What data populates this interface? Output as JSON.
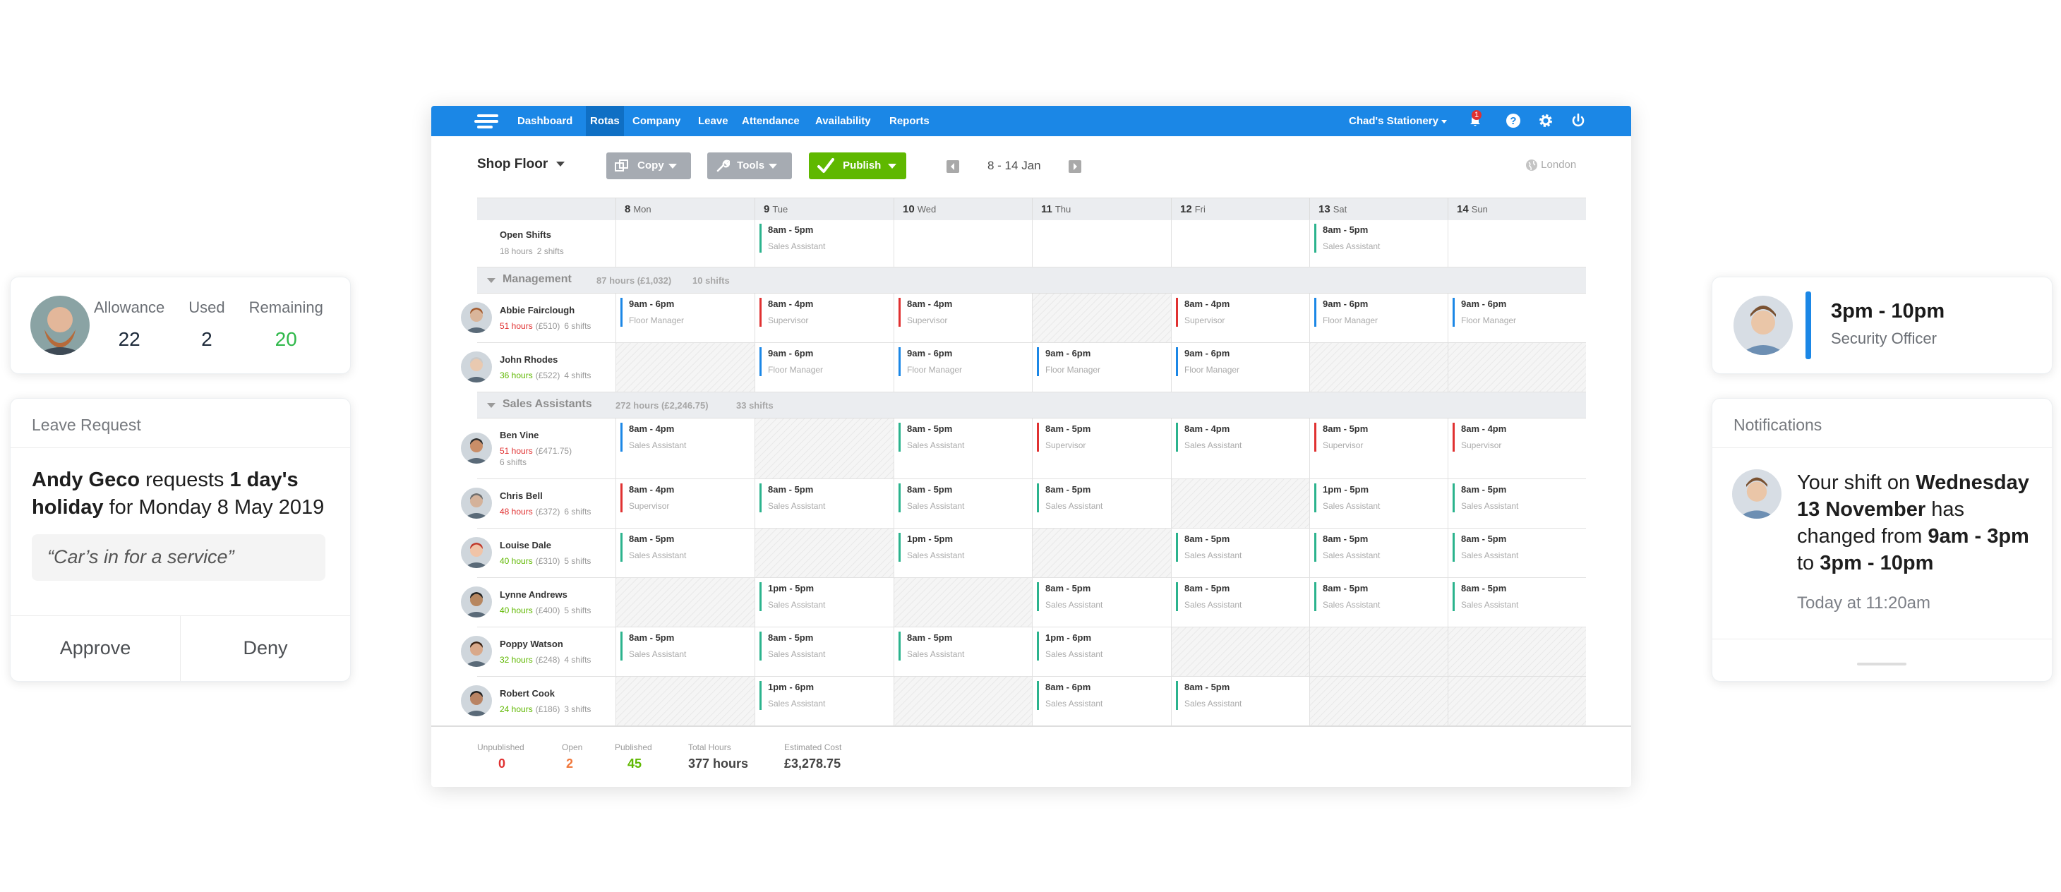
{
  "colors": {
    "brand": "#1b87e6",
    "green": "#5fb800",
    "blue_shift": "#1b87e6",
    "red_shift": "#e03131",
    "teal_shift": "#2bb38d",
    "over_hours": "#e03131",
    "ok_hours": "#5fb800",
    "remaining": "#2fb84a",
    "unpublished": "#e03131",
    "open": "#f0783c",
    "published": "#5fb800"
  },
  "allowance": {
    "allowance_label": "Allowance",
    "allowance_value": "22",
    "used_label": "Used",
    "used_value": "2",
    "remaining_label": "Remaining",
    "remaining_value": "20"
  },
  "leave_request": {
    "title": "Leave Request",
    "name": "Andy Geco",
    "requests": " requests ",
    "duration": "1 day's holiday",
    "for": " for ",
    "date": "Monday 8 May 2019",
    "quote": "“Car’s in for a service”",
    "approve": "Approve",
    "deny": "Deny"
  },
  "shift_card": {
    "time": "3pm - 10pm",
    "role": "Security Officer"
  },
  "notifications": {
    "title": "Notifications",
    "p1": "Your shift on ",
    "b1": "Wednesday 13 November",
    "p2": " has changed from ",
    "b2": "9am - 3pm",
    "p3": " to ",
    "b3": "3pm - 10pm",
    "time": "Today at 11:20am"
  },
  "nav": {
    "items": [
      "Dashboard",
      "Rotas",
      "Company",
      "Leave",
      "Attendance",
      "Availability",
      "Reports"
    ],
    "company": "Chad's Stationery",
    "notification_count": "1"
  },
  "toolbar": {
    "location": "Shop Floor",
    "copy": "Copy",
    "tools": "Tools",
    "publish": "Publish",
    "range": "8 - 14 Jan",
    "timezone": "London"
  },
  "days": [
    {
      "num": "8",
      "name": "Mon"
    },
    {
      "num": "9",
      "name": "Tue"
    },
    {
      "num": "10",
      "name": "Wed"
    },
    {
      "num": "11",
      "name": "Thu"
    },
    {
      "num": "12",
      "name": "Fri"
    },
    {
      "num": "13",
      "name": "Sat"
    },
    {
      "num": "14",
      "name": "Sun"
    }
  ],
  "open_shifts": {
    "name": "Open Shifts",
    "hours": "18 hours",
    "shifts": "2 shifts",
    "cells": [
      null,
      {
        "t": "8am - 5pm",
        "r": "Sales Assistant",
        "c": "teal"
      },
      null,
      null,
      null,
      {
        "t": "8am - 5pm",
        "r": "Sales Assistant",
        "c": "teal"
      },
      null
    ]
  },
  "groups": [
    {
      "name": "Management",
      "summary": "87 hours (£1,032)",
      "shifts": "10 shifts",
      "people": [
        {
          "name": "Abbie Fairclough",
          "hours": "51 hours",
          "cost": "(£510)",
          "shifts": "6 shifts",
          "over": true,
          "avatar": "a1",
          "cells": [
            {
              "t": "9am - 6pm",
              "r": "Floor Manager",
              "c": "blue"
            },
            {
              "t": "8am - 4pm",
              "r": "Supervisor",
              "c": "red"
            },
            {
              "t": "8am - 4pm",
              "r": "Supervisor",
              "c": "red"
            },
            "na",
            {
              "t": "8am - 4pm",
              "r": "Supervisor",
              "c": "red"
            },
            {
              "t": "9am - 6pm",
              "r": "Floor Manager",
              "c": "blue"
            },
            {
              "t": "9am - 6pm",
              "r": "Floor Manager",
              "c": "blue"
            }
          ]
        },
        {
          "name": "John Rhodes",
          "hours": "36 hours",
          "cost": "(£522)",
          "shifts": "4 shifts",
          "over": false,
          "avatar": "a2",
          "cells": [
            "na",
            {
              "t": "9am - 6pm",
              "r": "Floor Manager",
              "c": "blue"
            },
            {
              "t": "9am - 6pm",
              "r": "Floor Manager",
              "c": "blue"
            },
            {
              "t": "9am - 6pm",
              "r": "Floor Manager",
              "c": "blue"
            },
            {
              "t": "9am - 6pm",
              "r": "Floor Manager",
              "c": "blue"
            },
            "na",
            "na"
          ]
        }
      ]
    },
    {
      "name": "Sales Assistants",
      "summary": "272 hours (£2,246.75)",
      "shifts": "33 shifts",
      "people": [
        {
          "name": "Ben Vine",
          "hours": "51 hours",
          "cost": "(£471.75)",
          "shifts": "6 shifts",
          "over": true,
          "tall": true,
          "avatar": "a3",
          "cells": [
            {
              "t": "8am - 4pm",
              "r": "Sales Assistant",
              "c": "blue"
            },
            "na",
            {
              "t": "8am - 5pm",
              "r": "Sales Assistant",
              "c": "teal"
            },
            {
              "t": "8am - 5pm",
              "r": "Supervisor",
              "c": "red"
            },
            {
              "t": "8am - 4pm",
              "r": "Sales Assistant",
              "c": "teal"
            },
            {
              "t": "8am - 5pm",
              "r": "Supervisor",
              "c": "red"
            },
            {
              "t": "8am - 4pm",
              "r": "Supervisor",
              "c": "red"
            }
          ]
        },
        {
          "name": "Chris Bell",
          "hours": "48 hours",
          "cost": "(£372)",
          "shifts": "6 shifts",
          "over": true,
          "avatar": "a4",
          "cells": [
            {
              "t": "8am - 4pm",
              "r": "Supervisor",
              "c": "red"
            },
            {
              "t": "8am - 5pm",
              "r": "Sales Assistant",
              "c": "teal"
            },
            {
              "t": "8am - 5pm",
              "r": "Sales Assistant",
              "c": "teal"
            },
            {
              "t": "8am - 5pm",
              "r": "Sales Assistant",
              "c": "teal"
            },
            "na",
            {
              "t": "1pm - 5pm",
              "r": "Sales Assistant",
              "c": "teal"
            },
            {
              "t": "8am - 5pm",
              "r": "Sales Assistant",
              "c": "teal"
            }
          ]
        },
        {
          "name": "Louise Dale",
          "hours": "40 hours",
          "cost": "(£310)",
          "shifts": "5 shifts",
          "over": false,
          "avatar": "a5",
          "cells": [
            {
              "t": "8am - 5pm",
              "r": "Sales Assistant",
              "c": "teal"
            },
            "na",
            {
              "t": "1pm - 5pm",
              "r": "Sales Assistant",
              "c": "teal"
            },
            "na",
            {
              "t": "8am - 5pm",
              "r": "Sales Assistant",
              "c": "teal"
            },
            {
              "t": "8am - 5pm",
              "r": "Sales Assistant",
              "c": "teal"
            },
            {
              "t": "8am - 5pm",
              "r": "Sales Assistant",
              "c": "teal"
            }
          ]
        },
        {
          "name": "Lynne Andrews",
          "hours": "40 hours",
          "cost": "(£400)",
          "shifts": "5 shifts",
          "over": false,
          "avatar": "a6",
          "cells": [
            "na",
            {
              "t": "1pm - 5pm",
              "r": "Sales Assistant",
              "c": "teal"
            },
            "na",
            {
              "t": "8am - 5pm",
              "r": "Sales Assistant",
              "c": "teal"
            },
            {
              "t": "8am - 5pm",
              "r": "Sales Assistant",
              "c": "teal"
            },
            {
              "t": "8am - 5pm",
              "r": "Sales Assistant",
              "c": "teal"
            },
            {
              "t": "8am - 5pm",
              "r": "Sales Assistant",
              "c": "teal"
            }
          ]
        },
        {
          "name": "Poppy Watson",
          "hours": "32 hours",
          "cost": "(£248)",
          "shifts": "4 shifts",
          "over": false,
          "avatar": "a7",
          "cells": [
            {
              "t": "8am - 5pm",
              "r": "Sales Assistant",
              "c": "teal"
            },
            {
              "t": "8am - 5pm",
              "r": "Sales Assistant",
              "c": "teal"
            },
            {
              "t": "8am - 5pm",
              "r": "Sales Assistant",
              "c": "teal"
            },
            {
              "t": "1pm - 6pm",
              "r": "Sales Assistant",
              "c": "teal"
            },
            "na",
            "na",
            "na"
          ]
        },
        {
          "name": "Robert Cook",
          "hours": "24 hours",
          "cost": "(£186)",
          "shifts": "3 shifts",
          "over": false,
          "avatar": "a8",
          "cells": [
            "na",
            {
              "t": "1pm - 6pm",
              "r": "Sales Assistant",
              "c": "teal"
            },
            "na",
            {
              "t": "8am - 6pm",
              "r": "Sales Assistant",
              "c": "teal"
            },
            {
              "t": "8am - 5pm",
              "r": "Sales Assistant",
              "c": "teal"
            },
            "na",
            "na"
          ]
        }
      ]
    }
  ],
  "footer": {
    "unpublished_label": "Unpublished",
    "unpublished": "0",
    "open_label": "Open",
    "open": "2",
    "published_label": "Published",
    "published": "45",
    "total_label": "Total Hours",
    "total": "377 hours",
    "cost_label": "Estimated Cost",
    "cost": "£3,278.75"
  }
}
